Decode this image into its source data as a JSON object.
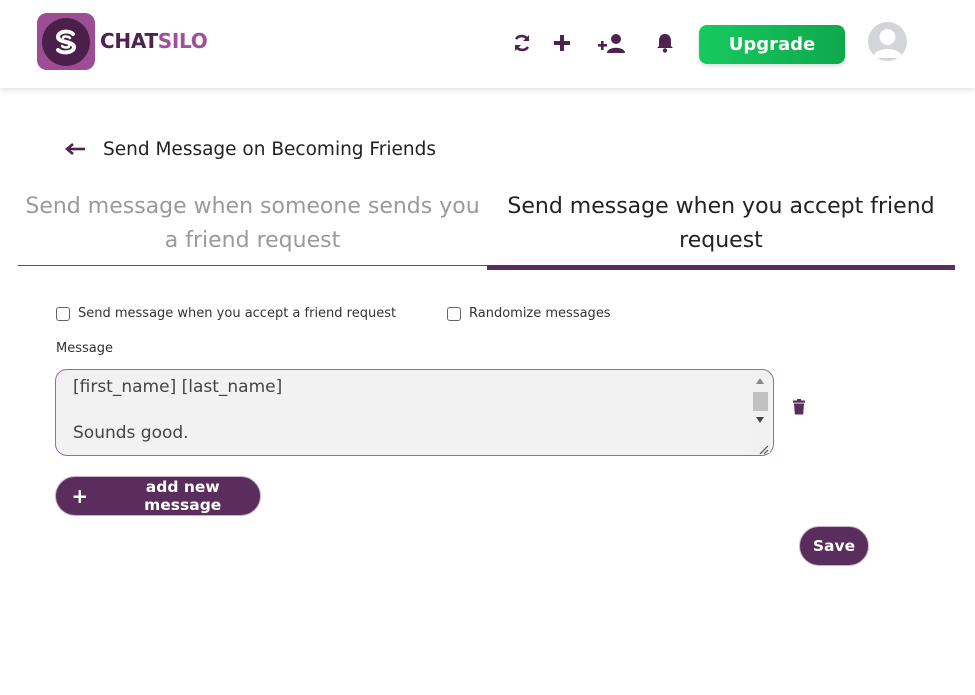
{
  "header": {
    "brand_part1": "CHAT",
    "brand_part2": "SILO",
    "icons": [
      "sync-icon",
      "plus-icon",
      "add-user-icon",
      "bell-icon"
    ],
    "upgrade_label": "Upgrade",
    "colors": {
      "brand_dark": "#4e2350",
      "brand_light": "#a0509a",
      "upgrade": "#13b955",
      "accent": "#5a2d5c"
    }
  },
  "page": {
    "title": "Send Message on Becoming Friends"
  },
  "tabs": [
    {
      "label": "Send message when someone sends you a friend request",
      "active": false
    },
    {
      "label": "Send message when you accept friend request",
      "active": true
    }
  ],
  "form": {
    "checkbox_accept_label": "Send message when you accept a friend request",
    "checkbox_accept_checked": false,
    "checkbox_random_label": "Randomize messages",
    "checkbox_random_checked": false,
    "message_label": "Message",
    "message_value": "[first_name] [last_name]\n\nSounds good.",
    "add_new_label": "add new message",
    "save_label": "Save"
  }
}
